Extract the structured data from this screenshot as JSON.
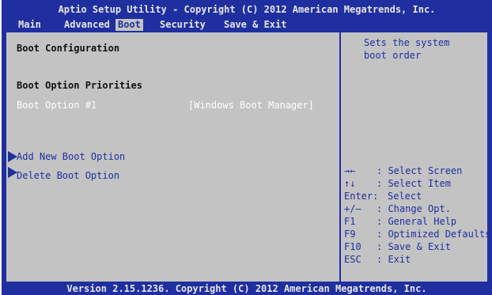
{
  "header": {
    "title": "Aptio Setup Utility - Copyright (C) 2012 American Megatrends, Inc."
  },
  "menu": {
    "items": [
      {
        "label": "Main"
      },
      {
        "label": "Advanced"
      },
      {
        "label": "Boot",
        "active": true
      },
      {
        "label": "Security"
      },
      {
        "label": "Save & Exit"
      }
    ]
  },
  "left": {
    "section_title": "Boot Configuration",
    "priorities_title": "Boot Option Priorities",
    "boot_option": {
      "label": "Boot Option #1",
      "value": "[Windows Boot Manager]"
    },
    "submenus": [
      {
        "label": "Add New Boot Option"
      },
      {
        "label": "Delete Boot Option"
      }
    ]
  },
  "help": {
    "lines": [
      "Sets the system",
      "boot order"
    ]
  },
  "keys": [
    {
      "key": "→←",
      "action": ": Select Screen"
    },
    {
      "key": "↑↓",
      "action": ": Select Item"
    },
    {
      "key": "Enter:",
      "action": "Select"
    },
    {
      "key": "+/—",
      "action": ": Change Opt."
    },
    {
      "key": "F1",
      "action": ": General Help"
    },
    {
      "key": "F9",
      "action": ": Optimized Defaults"
    },
    {
      "key": "F10",
      "action": ": Save & Exit"
    },
    {
      "key": "ESC",
      "action": ": Exit"
    }
  ],
  "footer": {
    "text": "Version 2.15.1236. Copyright (C) 2012 American Megatrends, Inc."
  },
  "colors": {
    "background": "#1f2fa0",
    "panel": "#c3c3c3",
    "highlight_text": "#ffffff"
  }
}
